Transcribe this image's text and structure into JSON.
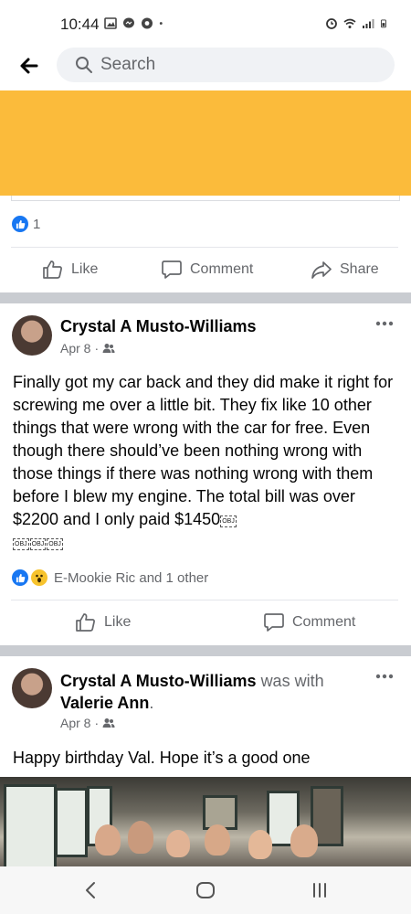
{
  "status_bar": {
    "time": "10:44"
  },
  "search": {
    "placeholder": "Search"
  },
  "prev_post": {
    "reaction_count": "1"
  },
  "actions": {
    "like": "Like",
    "comment": "Comment",
    "share": "Share"
  },
  "post1": {
    "author": "Crystal A Musto-Williams",
    "date": "Apr 8",
    "text_main": "Finally got my car back and they did make it right for screwing me over a little bit. They fix like 10 other things that were wrong with the car for free. Even though there should’ve been nothing wrong with those things if there was nothing wrong with them before I blew my engine. The total bill was over $2200 and I only paid $1450",
    "obj_glyph": "OBJ",
    "reactions": "E-Mookie Ric and 1 other"
  },
  "post2": {
    "author": "Crystal A Musto-Williams",
    "with_label": "was with",
    "tagged": "Valerie Ann",
    "tagged_suffix": ".",
    "date": "Apr 8",
    "text": "Happy birthday Val. Hope it’s a good one"
  },
  "colors": {
    "brand_blue": "#1877f2",
    "ad_banner": "#fbbb3b",
    "separator": "#c9ccd1"
  }
}
